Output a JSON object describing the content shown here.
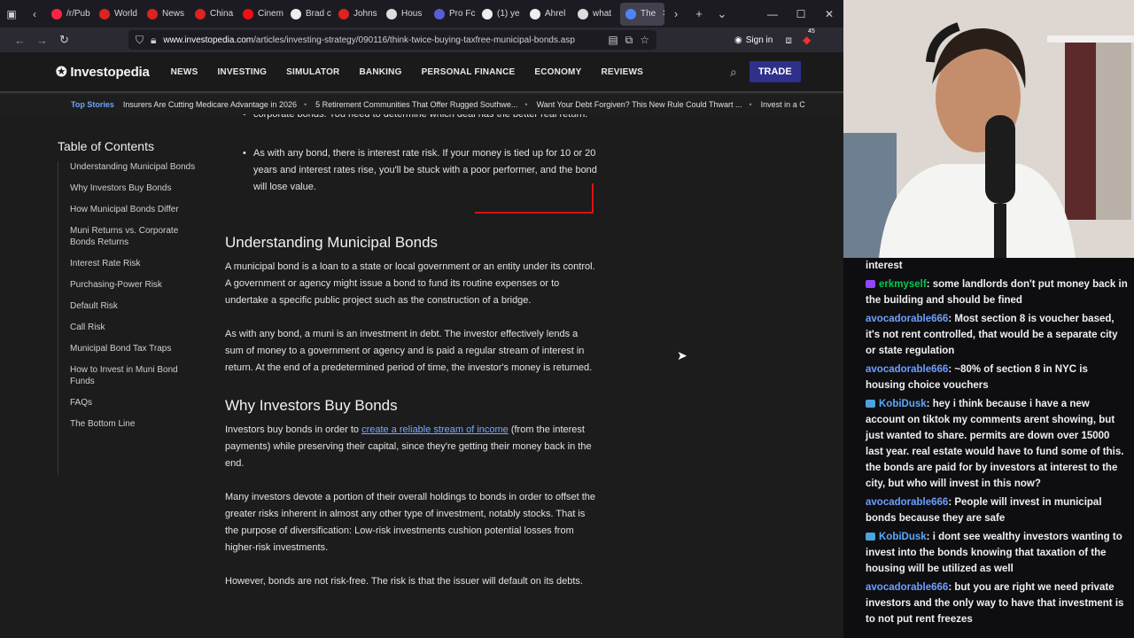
{
  "browser": {
    "tabs": [
      {
        "label": "/r/Pub",
        "color": "#f24"
      },
      {
        "label": "World",
        "color": "#d22"
      },
      {
        "label": "News",
        "color": "#d22"
      },
      {
        "label": "China",
        "color": "#d22"
      },
      {
        "label": "Cinem",
        "color": "#e11"
      },
      {
        "label": "Brad c",
        "color": "#eee"
      },
      {
        "label": "Johns",
        "color": "#d22"
      },
      {
        "label": "Hous",
        "color": "#ddd"
      },
      {
        "label": "Pro Fc",
        "color": "#5b5bd6"
      },
      {
        "label": "(1) ye",
        "color": "#eee"
      },
      {
        "label": "Ahrel",
        "color": "#eee"
      },
      {
        "label": "what",
        "color": "#ddd"
      },
      {
        "label": "The",
        "color": "#4c84ff"
      }
    ],
    "url": {
      "host": "www.investopedia.com",
      "path": "/articles/investing-strategy/090116/think-twice-buying-taxfree-municipal-bonds.asp"
    },
    "sign_in": "Sign in",
    "badge_count": "45"
  },
  "site": {
    "logo": "Investopedia",
    "nav": [
      "NEWS",
      "INVESTING",
      "SIMULATOR",
      "BANKING",
      "PERSONAL FINANCE",
      "ECONOMY",
      "REVIEWS"
    ],
    "trade": "TRADE",
    "top_stories_label": "Top Stories",
    "top_stories": [
      "Insurers Are Cutting Medicare Advantage in 2026",
      "5 Retirement Communities That Offer Rugged Southwe...",
      "Want Your Debt Forgiven? This New Rule Could Thwart ...",
      "Invest in a C"
    ]
  },
  "toc": {
    "title": "Table of Contents",
    "items": [
      "Understanding Municipal Bonds",
      "Why Investors Buy Bonds",
      "How Municipal Bonds Differ",
      "Muni Returns vs. Corporate Bonds Returns",
      "Interest Rate Risk",
      "Purchasing-Power Risk",
      "Default Risk",
      "Call Risk",
      "Municipal Bond Tax Traps",
      "How to Invest in Muni Bond Funds",
      "FAQs",
      "The Bottom Line"
    ]
  },
  "article": {
    "bullet_partial": "corporate bonds. You need to determine which deal has the better real return.",
    "bullet_rate": "As with any bond, there is interest rate risk. If your money is tied up for 10 or 20 years and interest rates rise, you'll be stuck with a poor performer, and the bond will lose value.",
    "h_understanding": "Understanding Municipal Bonds",
    "p1": "A municipal bond is a loan to a state or local government or an entity under its control. A government or agency might issue a bond to fund its routine expenses or to undertake a specific public project such as the construction of a bridge.",
    "p2": "As with any bond, a muni is an investment in debt. The investor effectively lends a sum of money to a government or agency and is paid a regular stream of interest in return. At the end of a predetermined period of time, the investor's money is returned.",
    "h_why": "Why Investors Buy Bonds",
    "p3_pre": "Investors buy bonds in order to ",
    "p3_link": "create a reliable stream of income",
    "p3_post": " (from the interest payments) while preserving their capital, since they're getting their money back in the end.",
    "p4": "Many investors devote a portion of their overall holdings to bonds in order to offset the greater risks inherent in almost any other type of investment, notably stocks. That is the purpose of diversification: Low-risk investments cushion potential losses from higher-risk investments.",
    "p5": "However, bonds are not risk-free. The risk is that the issuer will default on its debts."
  },
  "chat": [
    {
      "user": "",
      "text": "interest",
      "color": "#efeff1",
      "badge": ""
    },
    {
      "user": "erkmyself",
      "text": ": some landlords don't put money back in the building and should be fined",
      "color": "#00c853",
      "badge": "purple"
    },
    {
      "user": "avocadorable666",
      "text": ": Most section 8 is voucher based, it's not rent controlled, that would be a separate city or state regulation",
      "color": "#6d9eff",
      "badge": ""
    },
    {
      "user": "avocadorable666",
      "text": ": ~80% of section 8 in NYC is housing choice vouchers",
      "color": "#6d9eff",
      "badge": ""
    },
    {
      "user": "KobiDusk",
      "text": ": hey i think because i have a new account on tiktok my comments arent showing, but just wanted to share. permits are down over 15000 last year. real estate would have to fund some of this. the bonds are paid for by investors at interest to the city, but who will invest in this now?",
      "color": "#5aa9ff",
      "badge": "blue"
    },
    {
      "user": "avocadorable666",
      "text": ": People will invest in municipal bonds because they are safe",
      "color": "#6d9eff",
      "badge": ""
    },
    {
      "user": "KobiDusk",
      "text": ": i dont see wealthy investors wanting to invest into the bonds knowing that taxation of the housing will be utilized as well",
      "color": "#5aa9ff",
      "badge": "blue"
    },
    {
      "user": "avocadorable666",
      "text": ": but you are right we need private investors and the only way to have that investment is to not put rent freezes",
      "color": "#6d9eff",
      "badge": ""
    }
  ]
}
